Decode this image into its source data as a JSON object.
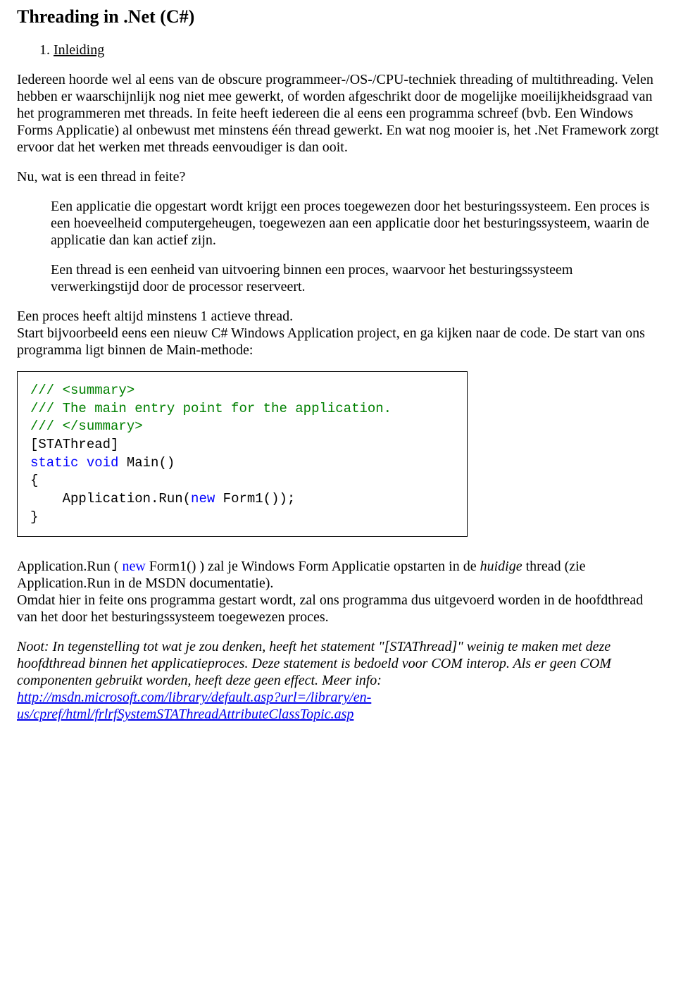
{
  "title": "Threading in .Net (C#)",
  "section": {
    "num": "1.",
    "label": "Inleiding"
  },
  "p1": "Iedereen hoorde wel al eens van de obscure programmeer-/OS-/CPU-techniek threading of multithreading. Velen hebben er waarschijnlijk nog niet mee gewerkt, of worden afgeschrikt door de mogelijke moeilijkheidsgraad van het programmeren met threads. In feite heeft iedereen die al eens een programma schreef (bvb. Een Windows Forms Applicatie) al onbewust met minstens één thread gewerkt. En wat nog mooier is, het .Net Framework zorgt ervoor dat het werken met threads eenvoudiger is dan ooit.",
  "p2": "Nu, wat is een thread in feite?",
  "p3": "Een applicatie die opgestart wordt krijgt een proces toegewezen door het besturingssysteem. Een proces is een hoeveelheid computergeheugen, toegewezen aan een applicatie door het besturingssysteem, waarin de applicatie dan kan actief zijn.",
  "p4": "Een thread is een eenheid van uitvoering binnen een proces, waarvoor het besturingssysteem verwerkingstijd door de processor reserveert.",
  "p5a": "Een proces heeft altijd minstens 1 actieve thread.",
  "p5b": "Start bijvoorbeeld eens een nieuw C# Windows Application project, en ga kijken naar de code. De start van ons programma ligt binnen de Main-methode:",
  "code": {
    "l1": "/// <summary>",
    "l2": "/// The main entry point for the application.",
    "l3": "/// </summary>",
    "l4": "[STAThread]",
    "l5a": "static",
    "l5b": "void",
    "l5c": "Main()",
    "l6": "{",
    "l7a": "    Application.Run(",
    "l7b": "new",
    "l7c": " Form1());",
    "l8": "}"
  },
  "p6": {
    "a": "Application.Run ( ",
    "new": "new",
    "b": " Form1() ) zal je Windows Form Applicatie opstarten in de ",
    "huidige": "huidige",
    "c": " thread (zie Application.Run in de MSDN documentatie).",
    "d": "Omdat hier in feite ons programma gestart wordt, zal ons programma dus uitgevoerd worden in de hoofdthread van het door het besturingssysteem toegewezen proces."
  },
  "p7": {
    "a": "Noot: In tegenstelling tot wat je zou denken, heeft het statement \"[STAThread]\" weinig te maken met deze hoofdthread binnen het applicatieproces. Deze statement is bedoeld voor COM interop. Als er geen COM componenten gebruikt worden, heeft deze geen effect. Meer info:",
    "link": "http://msdn.microsoft.com/library/default.asp?url=/library/en-us/cpref/html/frlrfSystemSTAThreadAttributeClassTopic.asp"
  }
}
